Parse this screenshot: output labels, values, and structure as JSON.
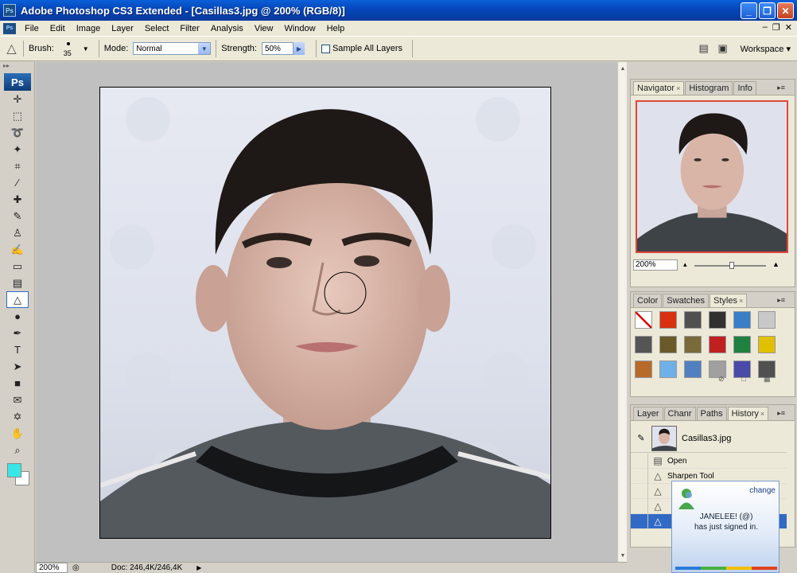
{
  "window": {
    "title": "Adobe Photoshop CS3 Extended - [Casillas3.jpg @ 200% (RGB/8)]",
    "app_icon": "Ps",
    "buttons": [
      "_",
      "❒",
      "✕"
    ]
  },
  "menu": {
    "items": [
      "File",
      "Edit",
      "Image",
      "Layer",
      "Select",
      "Filter",
      "Analysis",
      "View",
      "Window",
      "Help"
    ],
    "mdi_buttons": [
      "–",
      "❒",
      "✕"
    ]
  },
  "options": {
    "brush_label": "Brush:",
    "brush_size": "35",
    "mode_label": "Mode:",
    "mode_value": "Normal",
    "strength_label": "Strength:",
    "strength_value": "50%",
    "sample_all_layers": "Sample All Layers",
    "workspace": "Workspace ▾"
  },
  "toolbox": {
    "logo": "Ps",
    "tools": [
      {
        "name": "move-tool",
        "glyph": "✛"
      },
      {
        "name": "marquee-tool",
        "glyph": "⬚"
      },
      {
        "name": "lasso-tool",
        "glyph": "➰"
      },
      {
        "name": "magic-wand-tool",
        "glyph": "✦"
      },
      {
        "name": "crop-tool",
        "glyph": "⌗"
      },
      {
        "name": "slice-tool",
        "glyph": "∕"
      },
      {
        "name": "healing-brush-tool",
        "glyph": "✚"
      },
      {
        "name": "brush-tool",
        "glyph": "✎"
      },
      {
        "name": "clone-stamp-tool",
        "glyph": "♙"
      },
      {
        "name": "history-brush-tool",
        "glyph": "✍"
      },
      {
        "name": "eraser-tool",
        "glyph": "▭"
      },
      {
        "name": "gradient-tool",
        "glyph": "▤"
      },
      {
        "name": "sharpen-tool",
        "glyph": "△"
      },
      {
        "name": "dodge-tool",
        "glyph": "●"
      },
      {
        "name": "pen-tool",
        "glyph": "✒"
      },
      {
        "name": "type-tool",
        "glyph": "T"
      },
      {
        "name": "path-selection-tool",
        "glyph": "➤"
      },
      {
        "name": "shape-tool",
        "glyph": "■"
      },
      {
        "name": "notes-tool",
        "glyph": "✉"
      },
      {
        "name": "eyedropper-tool",
        "glyph": "✡"
      },
      {
        "name": "hand-tool",
        "glyph": "✋"
      },
      {
        "name": "zoom-tool",
        "glyph": "⌕"
      }
    ],
    "foreground_color": "#39e6e6",
    "background_color": "#ffffff"
  },
  "status": {
    "zoom": "200%",
    "doc": "Doc: 246,4K/246,4K",
    "play": "▶"
  },
  "navigator": {
    "tabs": [
      "Navigator",
      "Histogram",
      "Info"
    ],
    "zoom": "200%"
  },
  "styles_panel": {
    "tabs": [
      "Color",
      "Swatches",
      "Styles"
    ],
    "swatches": [
      "#ffffff",
      "#d83010",
      "#505050",
      "#303030",
      "#3a7ec8",
      "#c8c8c8",
      "#555555",
      "#6a5a2a",
      "#7a6a3a",
      "#c02020",
      "#208040",
      "#e0c000",
      "#b86a2a",
      "#70b0e8",
      "#5080c0",
      "#a0a0a0",
      "#4a4aa8",
      "#505050"
    ]
  },
  "history": {
    "tabs": [
      "Layer",
      "Chanr",
      "Paths",
      "History"
    ],
    "snapshot": "Casillas3.jpg",
    "rows": [
      "Open",
      "Sharpen Tool",
      "",
      ""
    ]
  },
  "notification": {
    "link": "change",
    "line1": "JANELEE! (@)",
    "line2": "has just signed in."
  }
}
